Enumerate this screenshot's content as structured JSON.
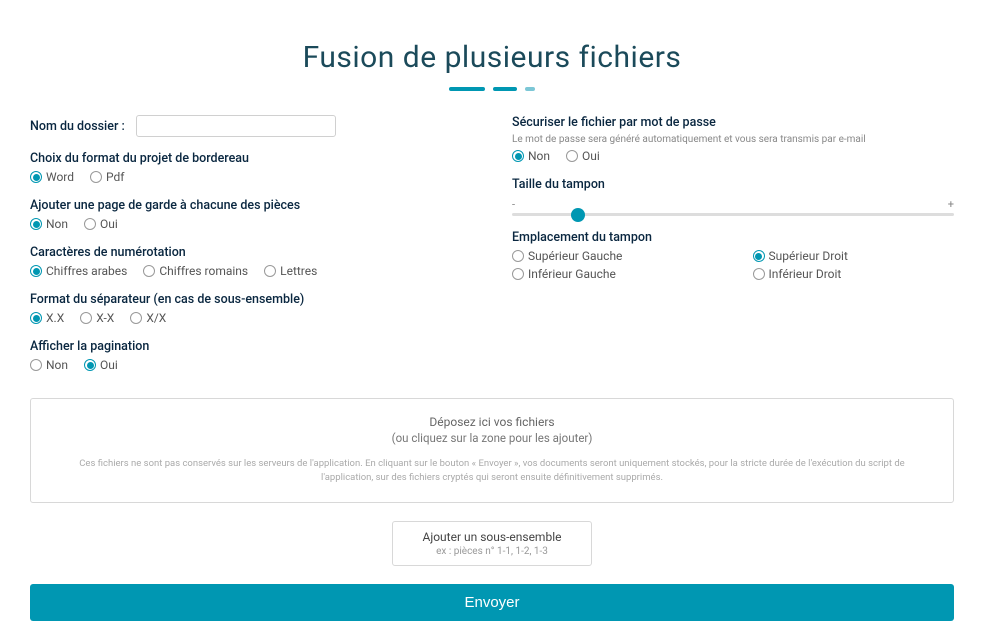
{
  "title": "Fusion de plusieurs fichiers",
  "folder_name": {
    "label": "Nom du dossier :",
    "value": ""
  },
  "format_choice": {
    "label": "Choix du format du projet de bordereau",
    "options": {
      "word": "Word",
      "pdf": "Pdf"
    },
    "selected": "word"
  },
  "cover_page": {
    "label": "Ajouter une page de garde à chacune des pièces",
    "options": {
      "non": "Non",
      "oui": "Oui"
    },
    "selected": "non"
  },
  "numbering": {
    "label": "Caractères de numérotation",
    "options": {
      "arabic": "Chiffres arabes",
      "roman": "Chiffres romains",
      "letters": "Lettres"
    },
    "selected": "arabic"
  },
  "separator": {
    "label": "Format du séparateur (en cas de sous-ensemble)",
    "options": {
      "dot": "X.X",
      "dash": "X-X",
      "slash": "X/X"
    },
    "selected": "dot"
  },
  "pagination": {
    "label": "Afficher la pagination",
    "options": {
      "non": "Non",
      "oui": "Oui"
    },
    "selected": "oui"
  },
  "secure": {
    "label": "Sécuriser le fichier par mot de passe",
    "sublabel": "Le mot de passe sera généré automatiquement et vous sera transmis par e-mail",
    "options": {
      "non": "Non",
      "oui": "Oui"
    },
    "selected": "non"
  },
  "stamp_size": {
    "label": "Taille du tampon",
    "min": "-",
    "max": "+"
  },
  "stamp_position": {
    "label": "Emplacement du tampon",
    "options": {
      "sup_gauche": "Supérieur Gauche",
      "sup_droit": "Supérieur Droit",
      "inf_gauche": "Inférieur Gauche",
      "inf_droit": "Inférieur Droit"
    },
    "selected": "sup_droit"
  },
  "dropzone": {
    "line1": "Déposez ici vos fichiers",
    "line2": "(ou cliquez sur la zone pour les ajouter)",
    "disclaimer": "Ces fichiers ne sont pas conservés sur les serveurs de l'application. En cliquant sur le bouton « Envoyer », vos documents seront uniquement stockés, pour la stricte durée de l'exécution du script de l'application, sur des fichiers cryptés qui seront ensuite définitivement supprimés."
  },
  "subensemble": {
    "title": "Ajouter un sous-ensemble",
    "hint": "ex : pièces n° 1-1, 1-2, 1-3"
  },
  "submit_label": "Envoyer"
}
